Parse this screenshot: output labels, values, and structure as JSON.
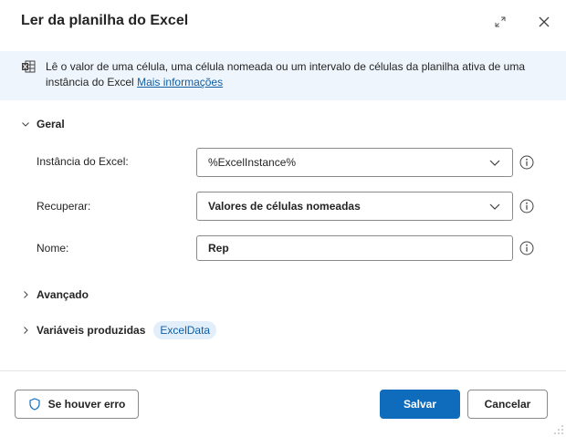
{
  "dialog": {
    "title": "Ler da planilha do Excel"
  },
  "info": {
    "text": "Lê o valor de uma célula, uma célula nomeada ou um intervalo de células da planilha ativa de uma instância do Excel",
    "link": "Mais informações"
  },
  "sections": {
    "general": "Geral",
    "advanced": "Avançado",
    "variables": "Variáveis produzidas"
  },
  "fields": {
    "instance": {
      "label": "Instância do Excel:",
      "value": "%ExcelInstance%"
    },
    "retrieve": {
      "label": "Recuperar:",
      "value": "Valores de células nomeadas"
    },
    "name": {
      "label": "Nome:",
      "value": "Rep"
    }
  },
  "variables": {
    "produced": "ExcelData"
  },
  "footer": {
    "on_error": "Se houver erro",
    "save": "Salvar",
    "cancel": "Cancelar"
  },
  "colors": {
    "accent": "#0f6cbd",
    "info_bg": "#eff5fc",
    "badge_bg": "#e3eefb",
    "link": "#115ea3"
  }
}
